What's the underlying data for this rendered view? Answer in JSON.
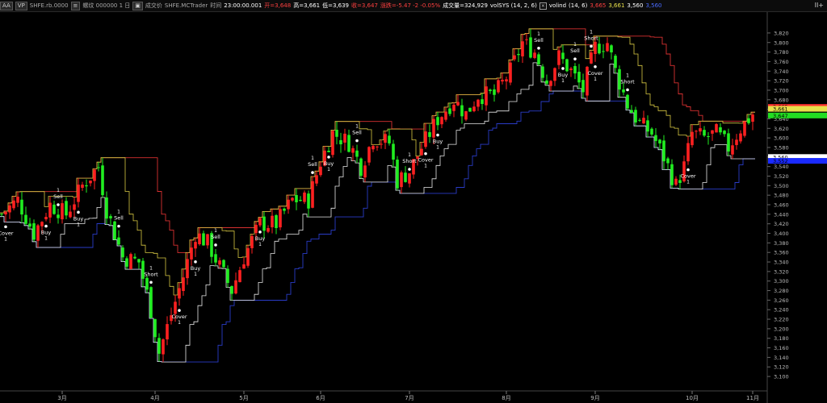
{
  "toolbar": {
    "tag1": "AA",
    "tag2": "VP",
    "symbol_label": "SHFE.rb.0000",
    "tag3": "≡",
    "info": "螺纹 000000 1 日",
    "tag4": "▣",
    "volume_type": "成交价",
    "source": "SHFE.MCTrader",
    "time_label": "时间",
    "time_value": "23:00:00.001",
    "open": "开=3,648",
    "high": "高=3,661",
    "low": "低=3,639",
    "close": "收=3,647",
    "change": "涨跌=-5.47 -2 -0.05%",
    "volume": "成交量=324,929",
    "indicator": "volSYS (14, 2, 6)",
    "volind_label": "volind",
    "volind_params": "(14, 6)",
    "volind_v1": "3,665",
    "volind_v2": "3,661",
    "volind_v3": "3,560",
    "volind_v4": "3,560",
    "menu_label": "II+"
  },
  "colors": {
    "up": "#ff2020",
    "down": "#20ee20",
    "bg": "#000000",
    "upper_channel": "#d83030",
    "lower_channel": "#2a3cc8",
    "inner_upper": "#d8c843",
    "inner_lower": "#e8e8e8"
  },
  "chart_data": {
    "type": "candlestick",
    "y_ticks": [
      "3,820",
      "3,800",
      "3,780",
      "3,760",
      "3,740",
      "3,720",
      "3,700",
      "3,680",
      "3,660",
      "3,640",
      "3,620",
      "3,600",
      "3,580",
      "3,560",
      "3,540",
      "3,520",
      "3,500",
      "3,480",
      "3,460",
      "3,440",
      "3,420",
      "3,400",
      "3,380",
      "3,360",
      "3,340",
      "3,320",
      "3,300",
      "3,280",
      "3,260",
      "3,240",
      "3,220",
      "3,200",
      "3,180",
      "3,160",
      "3,140",
      "3,120",
      "3,100"
    ],
    "ylim": [
      3090,
      3830
    ],
    "x_months": [
      {
        "label": "3月",
        "idx": 15
      },
      {
        "label": "4月",
        "idx": 38
      },
      {
        "label": "5月",
        "idx": 60
      },
      {
        "label": "6月",
        "idx": 79
      },
      {
        "label": "7月",
        "idx": 101
      },
      {
        "label": "8月",
        "idx": 125
      },
      {
        "label": "9月",
        "idx": 147
      },
      {
        "label": "10月",
        "idx": 171
      },
      {
        "label": "11月",
        "idx": 186
      }
    ],
    "price_labels": [
      {
        "value": 3665,
        "color": "#ff3030"
      },
      {
        "value": 3661,
        "color": "#e8e04a"
      },
      {
        "value": 3647,
        "color": "#22dd22"
      },
      {
        "value": 3560,
        "color": "#ffffff"
      },
      {
        "value": 3552,
        "color": "#1a2aff"
      }
    ],
    "anchors": [
      [
        0,
        3440
      ],
      [
        4,
        3470
      ],
      [
        8,
        3400
      ],
      [
        12,
        3460
      ],
      [
        16,
        3440
      ],
      [
        20,
        3500
      ],
      [
        24,
        3540
      ],
      [
        26,
        3450
      ],
      [
        30,
        3350
      ],
      [
        34,
        3340
      ],
      [
        37,
        3240
      ],
      [
        39,
        3150
      ],
      [
        42,
        3230
      ],
      [
        45,
        3310
      ],
      [
        48,
        3400
      ],
      [
        51,
        3380
      ],
      [
        54,
        3330
      ],
      [
        57,
        3280
      ],
      [
        60,
        3350
      ],
      [
        64,
        3420
      ],
      [
        68,
        3420
      ],
      [
        72,
        3470
      ],
      [
        76,
        3470
      ],
      [
        79,
        3550
      ],
      [
        82,
        3610
      ],
      [
        86,
        3590
      ],
      [
        89,
        3540
      ],
      [
        92,
        3600
      ],
      [
        96,
        3590
      ],
      [
        98,
        3510
      ],
      [
        101,
        3530
      ],
      [
        104,
        3580
      ],
      [
        108,
        3640
      ],
      [
        112,
        3680
      ],
      [
        115,
        3650
      ],
      [
        118,
        3690
      ],
      [
        122,
        3690
      ],
      [
        126,
        3740
      ],
      [
        129,
        3800
      ],
      [
        132,
        3780
      ],
      [
        135,
        3720
      ],
      [
        138,
        3770
      ],
      [
        141,
        3740
      ],
      [
        144,
        3700
      ],
      [
        147,
        3790
      ],
      [
        150,
        3800
      ],
      [
        152,
        3740
      ],
      [
        155,
        3670
      ],
      [
        158,
        3630
      ],
      [
        161,
        3610
      ],
      [
        164,
        3560
      ],
      [
        167,
        3500
      ],
      [
        169,
        3540
      ],
      [
        171,
        3610
      ],
      [
        174,
        3600
      ],
      [
        177,
        3610
      ],
      [
        180,
        3580
      ],
      [
        183,
        3620
      ],
      [
        186,
        3650
      ]
    ],
    "signals": [
      {
        "idx": 1,
        "text": "Cover",
        "qty": "1",
        "type": "cover"
      },
      {
        "idx": 11,
        "text": "Buy",
        "qty": "1",
        "type": "buy"
      },
      {
        "idx": 14,
        "text": "Sell",
        "qty": "1",
        "type": "sell"
      },
      {
        "idx": 19,
        "text": "Buy",
        "qty": "1",
        "type": "buy"
      },
      {
        "idx": 29,
        "text": "Sell",
        "qty": "1",
        "type": "sell"
      },
      {
        "idx": 37,
        "text": "Short",
        "qty": "1",
        "type": "short"
      },
      {
        "idx": 44,
        "text": "Cover",
        "qty": "1",
        "type": "cover"
      },
      {
        "idx": 48,
        "text": "Buy",
        "qty": "1",
        "type": "buy"
      },
      {
        "idx": 53,
        "text": "Sell",
        "qty": "1",
        "type": "sell"
      },
      {
        "idx": 64,
        "text": "Buy",
        "qty": "1",
        "type": "buy"
      },
      {
        "idx": 77,
        "text": "Sell",
        "qty": "1",
        "type": "sell"
      },
      {
        "idx": 81,
        "text": "Buy",
        "qty": "1",
        "type": "buy"
      },
      {
        "idx": 88,
        "text": "Sell",
        "qty": "1",
        "type": "sell"
      },
      {
        "idx": 101,
        "text": "Short",
        "qty": "1",
        "type": "short"
      },
      {
        "idx": 105,
        "text": "Cover",
        "qty": "1",
        "type": "cover"
      },
      {
        "idx": 108,
        "text": "Buy",
        "qty": "1",
        "type": "buy"
      },
      {
        "idx": 133,
        "text": "Sell",
        "qty": "1",
        "type": "sell"
      },
      {
        "idx": 139,
        "text": "Buy",
        "qty": "1",
        "type": "buy"
      },
      {
        "idx": 142,
        "text": "Sell",
        "qty": "1",
        "type": "sell"
      },
      {
        "idx": 146,
        "text": "Short",
        "qty": "1",
        "type": "short"
      },
      {
        "idx": 147,
        "text": "Cover",
        "qty": "1",
        "type": "cover"
      },
      {
        "idx": 155,
        "text": "Short",
        "qty": "1",
        "type": "short"
      },
      {
        "idx": 170,
        "text": "Cover",
        "qty": "1",
        "type": "cover"
      }
    ]
  }
}
